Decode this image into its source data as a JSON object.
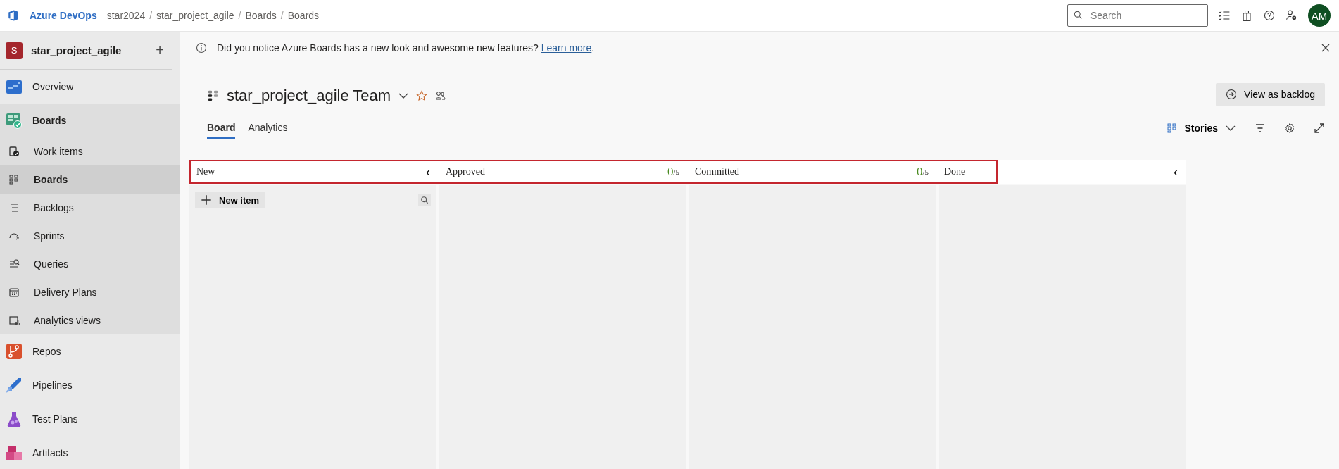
{
  "top_bar": {
    "brand": "Azure DevOps",
    "breadcrumbs": [
      "star2024",
      "star_project_agile",
      "Boards",
      "Boards"
    ],
    "separator": "/",
    "search": {
      "placeholder": "Search"
    },
    "avatar": "AM"
  },
  "sidebar": {
    "project": {
      "initial": "S",
      "name": "star_project_agile",
      "add": "+"
    },
    "items": [
      {
        "label": "Overview",
        "selected": false,
        "expanded": false
      },
      {
        "label": "Boards",
        "selected": false,
        "expanded": true,
        "children": [
          {
            "label": "Work items",
            "selected": false
          },
          {
            "label": "Boards",
            "selected": true
          },
          {
            "label": "Backlogs",
            "selected": false
          },
          {
            "label": "Sprints",
            "selected": false
          },
          {
            "label": "Queries",
            "selected": false
          },
          {
            "label": "Delivery Plans",
            "selected": false
          },
          {
            "label": "Analytics views",
            "selected": false
          }
        ]
      },
      {
        "label": "Repos",
        "selected": false,
        "expanded": false
      },
      {
        "label": "Pipelines",
        "selected": false,
        "expanded": false
      },
      {
        "label": "Test Plans",
        "selected": false,
        "expanded": false
      },
      {
        "label": "Artifacts",
        "selected": false,
        "expanded": false
      }
    ]
  },
  "banner": {
    "text": "Did you notice Azure Boards has a new look and awesome new features?",
    "link": "Learn more",
    "after": "."
  },
  "header": {
    "team": "star_project_agile Team",
    "view_button": "View as backlog",
    "tabs": [
      {
        "label": "Board",
        "selected": true
      },
      {
        "label": "Analytics",
        "selected": false
      }
    ],
    "level_picker": "Stories"
  },
  "board": {
    "highlighted": true,
    "columns": [
      {
        "title": "New",
        "collapse": "‹",
        "new_item": "New item"
      },
      {
        "title": "Approved",
        "count": "0",
        "limit": "/5"
      },
      {
        "title": "Committed",
        "count": "0",
        "limit": "/5"
      },
      {
        "title": "Done",
        "collapse": "‹"
      }
    ]
  }
}
